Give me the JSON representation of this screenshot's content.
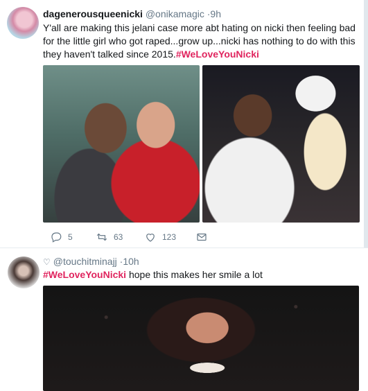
{
  "tweet1": {
    "display_name": "dagenerousqueenicki",
    "handle": "@onikamagic",
    "time": "9h",
    "text": "Y'all are making this jelani case more abt hating on nicki then feeling bad for the little girl who got raped...grow up...nicki has nothing to do with this they haven't talked since 2015.",
    "hashtag": "#WeLoveYouNicki",
    "actions": {
      "reply_count": "5",
      "retweet_count": "63",
      "like_count": "123"
    }
  },
  "tweet2": {
    "handle": "@touchitminajj",
    "time": "10h",
    "hashtag": "#WeLoveYouNicki",
    "text": " hope this makes her smile a lot"
  },
  "colors": {
    "accent": "#e0245e",
    "muted": "#657786"
  }
}
